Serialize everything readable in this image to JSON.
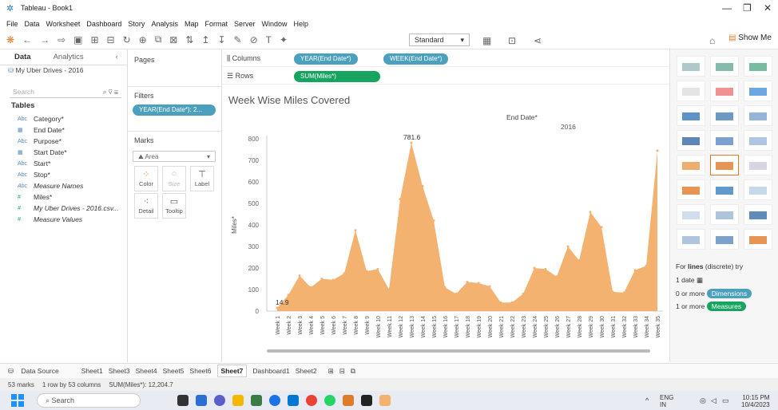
{
  "window": {
    "title": "Tableau - Book1"
  },
  "menu": [
    "File",
    "Data",
    "Worksheet",
    "Dashboard",
    "Story",
    "Analysis",
    "Map",
    "Format",
    "Server",
    "Window",
    "Help"
  ],
  "toolbar": {
    "fit": "Standard",
    "show_me": "Show Me"
  },
  "data_pane": {
    "tabs": [
      "Data",
      "Analytics"
    ],
    "datasource": "My Uber Drives - 2016",
    "search_placeholder": "Search",
    "tables_heading": "Tables",
    "fields": [
      {
        "type": "Abc",
        "name": "Category*",
        "italic": false
      },
      {
        "type": "date",
        "name": "End Date*",
        "italic": false
      },
      {
        "type": "Abc",
        "name": "Purpose*",
        "italic": false
      },
      {
        "type": "date",
        "name": "Start Date*",
        "italic": false
      },
      {
        "type": "Abc",
        "name": "Start*",
        "italic": false
      },
      {
        "type": "Abc",
        "name": "Stop*",
        "italic": false
      },
      {
        "type": "Abc",
        "name": "Measure Names",
        "italic": true
      },
      {
        "type": "#",
        "name": "Miles*",
        "italic": false
      },
      {
        "type": "#",
        "name": "My Uber Drives - 2016.csv...",
        "italic": true
      },
      {
        "type": "#",
        "name": "Measure Values",
        "italic": true
      }
    ]
  },
  "cards": {
    "pages": "Pages",
    "filters": "Filters",
    "filter_pill": "YEAR(End Date*): 2...",
    "marks": "Marks",
    "mark_type": "Area",
    "mark_buttons": [
      "Color",
      "Size",
      "Label",
      "Detail",
      "Tooltip"
    ]
  },
  "shelves": {
    "columns_label": "Columns",
    "rows_label": "Rows",
    "columns": [
      "YEAR(End Date*)",
      "WEEK(End Date*)"
    ],
    "rows": [
      "SUM(Miles*)"
    ]
  },
  "colors": {
    "area": "#f4b271",
    "pill_blue": "#4aa0bd",
    "pill_green": "#16a460",
    "accent": "#1f77b4"
  },
  "chart_data": {
    "type": "area",
    "title": "Week Wise Miles Covered",
    "header_field": "End Date*",
    "header_value": "2016",
    "ylabel": "Miles*",
    "ylim": [
      0,
      800
    ],
    "yticks": [
      0,
      100,
      200,
      300,
      400,
      500,
      600,
      700,
      800
    ],
    "categories": [
      "Week 1",
      "Week 2",
      "Week 3",
      "Week 4",
      "Week 5",
      "Week 6",
      "Week 7",
      "Week 8",
      "Week 9",
      "Week 10",
      "Week 11",
      "Week 12",
      "Week 13",
      "Week 14",
      "Week 15",
      "Week 16",
      "Week 17",
      "Week 18",
      "Week 19",
      "Week 20",
      "Week 21",
      "Week 22",
      "Week 23",
      "Week 24",
      "Week 25",
      "Week 26",
      "Week 27",
      "Week 28",
      "Week 29",
      "Week 30",
      "Week 31",
      "Week 32",
      "Week 33",
      "Week 34",
      "Week 35"
    ],
    "values": [
      14.9,
      75,
      165,
      110,
      150,
      145,
      175,
      375,
      185,
      195,
      100,
      520,
      781.6,
      580,
      420,
      110,
      80,
      135,
      130,
      115,
      40,
      40,
      80,
      200,
      195,
      160,
      300,
      235,
      460,
      390,
      90,
      85,
      190,
      210,
      745
    ],
    "annotations": [
      {
        "index": 0,
        "label": "14.9"
      },
      {
        "index": 12,
        "label": "781.6"
      }
    ]
  },
  "showme": {
    "hint_prefix": "For",
    "hint_bold": "lines",
    "hint_suffix": "(discrete) try",
    "req1": "1 date",
    "req2": "0 or more",
    "req2_pill": "Dimensions",
    "req3": "1 or more",
    "req3_pill": "Measures"
  },
  "sheets": {
    "data_source": "Data Source",
    "tabs": [
      "Sheet1",
      "Sheet3",
      "Sheet4",
      "Sheet5",
      "Sheet6",
      "Sheet7",
      "Dashboard1",
      "Sheet2"
    ],
    "active": "Sheet7"
  },
  "status": {
    "marks": "53 marks",
    "grid": "1 row by 53 columns",
    "sum": "SUM(Miles*): 12,204.7"
  },
  "taskbar": {
    "search": "Search",
    "lang": "ENG",
    "region": "IN",
    "time": "10:15 PM",
    "date": "10/4/2023"
  }
}
